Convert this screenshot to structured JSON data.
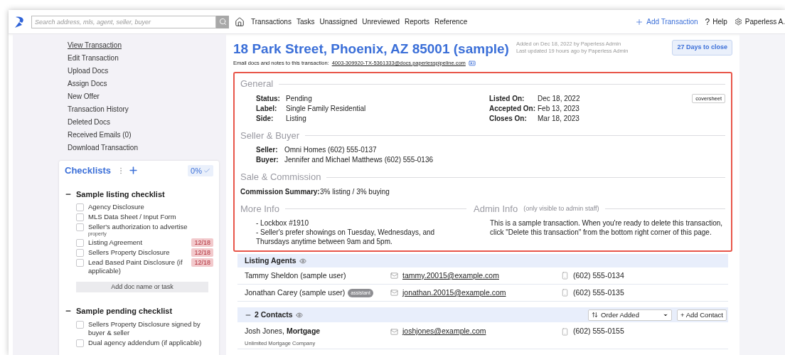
{
  "nav": {
    "search_placeholder": "Search address, mls, agent, seller, buyer",
    "links": [
      "Transactions",
      "Tasks",
      "Unassigned",
      "Unreviewed",
      "Reports",
      "Reference"
    ],
    "add_transaction": "Add Transaction",
    "help_icon": "?",
    "help": "Help",
    "user": "Paperless A."
  },
  "sidebar": {
    "menu": [
      {
        "label": "View Transaction",
        "selected": true
      },
      {
        "label": "Edit Transaction",
        "selected": false
      },
      {
        "label": "Upload Docs",
        "selected": false
      },
      {
        "label": "Assign Docs",
        "selected": false
      },
      {
        "label": "New Offer",
        "selected": false
      },
      {
        "label": "Transaction History",
        "selected": false
      },
      {
        "label": "Deleted Docs",
        "selected": false
      },
      {
        "label": "Received Emails (0)",
        "selected": false
      },
      {
        "label": "Download Transaction",
        "selected": false
      }
    ],
    "checklists": {
      "title": "Checklists",
      "percent": "0%",
      "groups": [
        {
          "title": "Sample listing checklist",
          "expanded": true,
          "add_button": "Add doc name or task",
          "items": [
            {
              "label": "Agency Disclosure",
              "checked": false
            },
            {
              "label": "MLS Data Sheet / Input Form",
              "checked": false
            },
            {
              "label": "Seller's authorization to advertise",
              "note": "property",
              "checked": false
            },
            {
              "label": "Listing Agreement",
              "checked": false,
              "due": "12/18"
            },
            {
              "label": "Sellers Property Disclosure",
              "checked": false,
              "due": "12/18"
            },
            {
              "label": "Lead Based Paint Disclosure (if applicable)",
              "checked": false,
              "due": "12/18"
            }
          ]
        },
        {
          "title": "Sample pending checklist",
          "expanded": true,
          "items": [
            {
              "label": "Sellers Property Disclosure signed by buyer & seller",
              "checked": false
            },
            {
              "label": "Dual agency addendum (if applicable)",
              "checked": false
            }
          ]
        }
      ]
    }
  },
  "header": {
    "title": "18 Park Street, Phoenix, AZ 85001 (sample)",
    "added": "Added on Dec 18, 2022 by Paperless Admin",
    "updated": "Last updated 19 hours ago by Paperless Admin",
    "email_label": "Email docs and notes to this transaction:",
    "email": "4003-309920-TX-5361333@docs.paperlesspipeline.com",
    "days_badge": "27 Days to close"
  },
  "details": {
    "general": {
      "title": "General",
      "coversheet": "coversheet",
      "left": [
        {
          "label": "Status:",
          "value": "Pending"
        },
        {
          "label": "Label:",
          "value": "Single Family Residential"
        },
        {
          "label": "Side:",
          "value": "Listing"
        }
      ],
      "right": [
        {
          "label": "Listed On:",
          "value": "Dec 18, 2022"
        },
        {
          "label": "Accepted On:",
          "value": "Feb 13, 2023"
        },
        {
          "label": "Closes On:",
          "value": "Mar 18, 2023"
        }
      ]
    },
    "seller_buyer": {
      "title": "Seller & Buyer",
      "fields": [
        {
          "label": "Seller:",
          "value": "Omni Homes (602) 555-0137"
        },
        {
          "label": "Buyer:",
          "value": "Jennifer and Michael Matthews (602) 555-0136"
        }
      ]
    },
    "sale_commission": {
      "title": "Sale & Commission",
      "fields": [
        {
          "label": "Commission Summary:",
          "value": "3% listing / 3% buying"
        }
      ]
    },
    "more_info": {
      "title": "More Info",
      "lines": [
        "- Lockbox #1910",
        "- Seller's prefer showings on Tuesday, Wednesdays, and Thursdays anytime between 9am and 5pm."
      ]
    },
    "admin_info": {
      "title": "Admin Info",
      "note": "(only visible to admin staff)",
      "text": "This is a sample transaction. When you're ready to delete this transaction, click \"Delete this transaction\" from the bottom right corner of this page."
    }
  },
  "listing_agents": {
    "title": "Listing Agents",
    "rows": [
      {
        "name": "Tammy Sheldon (sample user)",
        "email": "tammy.20015@example.com",
        "phone": "(602) 555-0134"
      },
      {
        "name": "Jonathan Carey (sample user)",
        "tag": "assistant",
        "email": "jonathan.20015@example.com",
        "phone": "(602) 555-0135"
      }
    ]
  },
  "contacts": {
    "title": "2 Contacts",
    "expanded": true,
    "sort": "Order Added",
    "add_button": "+ Add Contact",
    "rows": [
      {
        "name": "Josh Jones, **Mortgage**",
        "company": "Unlimited Mortgage Company",
        "email": "joshjones@example.com",
        "phone": "(602) 555-0155"
      }
    ]
  }
}
